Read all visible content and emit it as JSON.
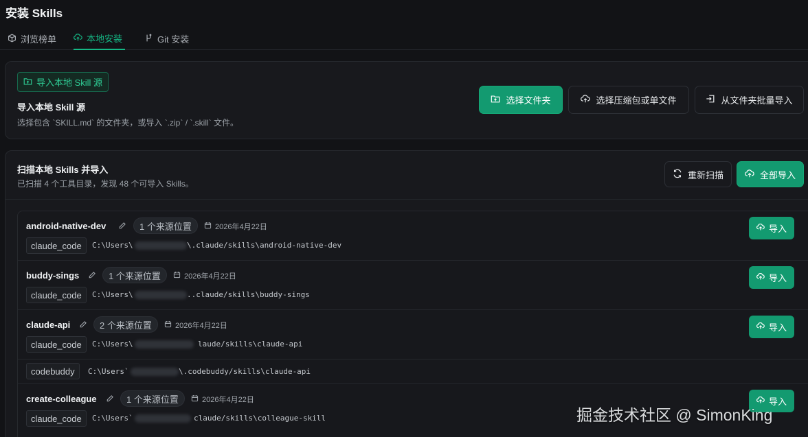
{
  "page": {
    "title": "安装 Skills"
  },
  "tabs": [
    {
      "label": "浏览榜单",
      "icon": "cube-icon",
      "active": false
    },
    {
      "label": "本地安装",
      "icon": "cloud-upload-icon",
      "active": true
    },
    {
      "label": "Git 安装",
      "icon": "git-icon",
      "active": false
    }
  ],
  "import_card": {
    "chip_label": "导入本地 Skill 源",
    "heading": "导入本地 Skill 源",
    "description": "选择包含 `SKILL.md` 的文件夹，或导入 `.zip` / `.skill` 文件。",
    "buttons": {
      "choose_folder": "选择文件夹",
      "choose_archive": "选择压缩包或单文件",
      "batch_import": "从文件夹批量导入"
    }
  },
  "scan_card": {
    "heading": "扫描本地 Skills 并导入",
    "summary": "已扫描 4 个工具目录，发现 48 个可导入 Skills。",
    "rescan_label": "重新扫描",
    "import_all_label": "全部导入",
    "import_label": "导入",
    "skills": [
      {
        "name": "android-native-dev",
        "sources_badge": "1 个来源位置",
        "date": "2026年4月22日",
        "tool": "claude_code",
        "path_prefix": "C:\\Users\\",
        "path_suffix": "\\.claude/skills\\android-native-dev"
      },
      {
        "name": "buddy-sings",
        "sources_badge": "1 个来源位置",
        "date": "2026年4月22日",
        "tool": "claude_code",
        "path_prefix": "C:\\Users\\",
        "path_suffix": "..claude/skills\\buddy-sings"
      },
      {
        "name": "claude-api",
        "sources_badge": "2 个来源位置",
        "date": "2026年4月22日",
        "tool": "claude_code",
        "path_prefix": "C:\\Users\\",
        "path_suffix": "laude/skills\\claude-api",
        "extra_tool": "codebuddy",
        "extra_path_prefix": "C:\\Users`",
        "extra_path_suffix": "\\.codebuddy/skills\\claude-api"
      },
      {
        "name": "create-colleague",
        "sources_badge": "1 个来源位置",
        "date": "2026年4月22日",
        "tool": "claude_code",
        "path_prefix": "C:\\Users`",
        "path_suffix": "claude/skills\\colleague-skill"
      }
    ]
  },
  "watermark": "掘金技术社区 @ SimonKing",
  "colors": {
    "accent": "#139a70",
    "accent_text": "#15b885",
    "background": "#121316",
    "card": "#18191d"
  }
}
